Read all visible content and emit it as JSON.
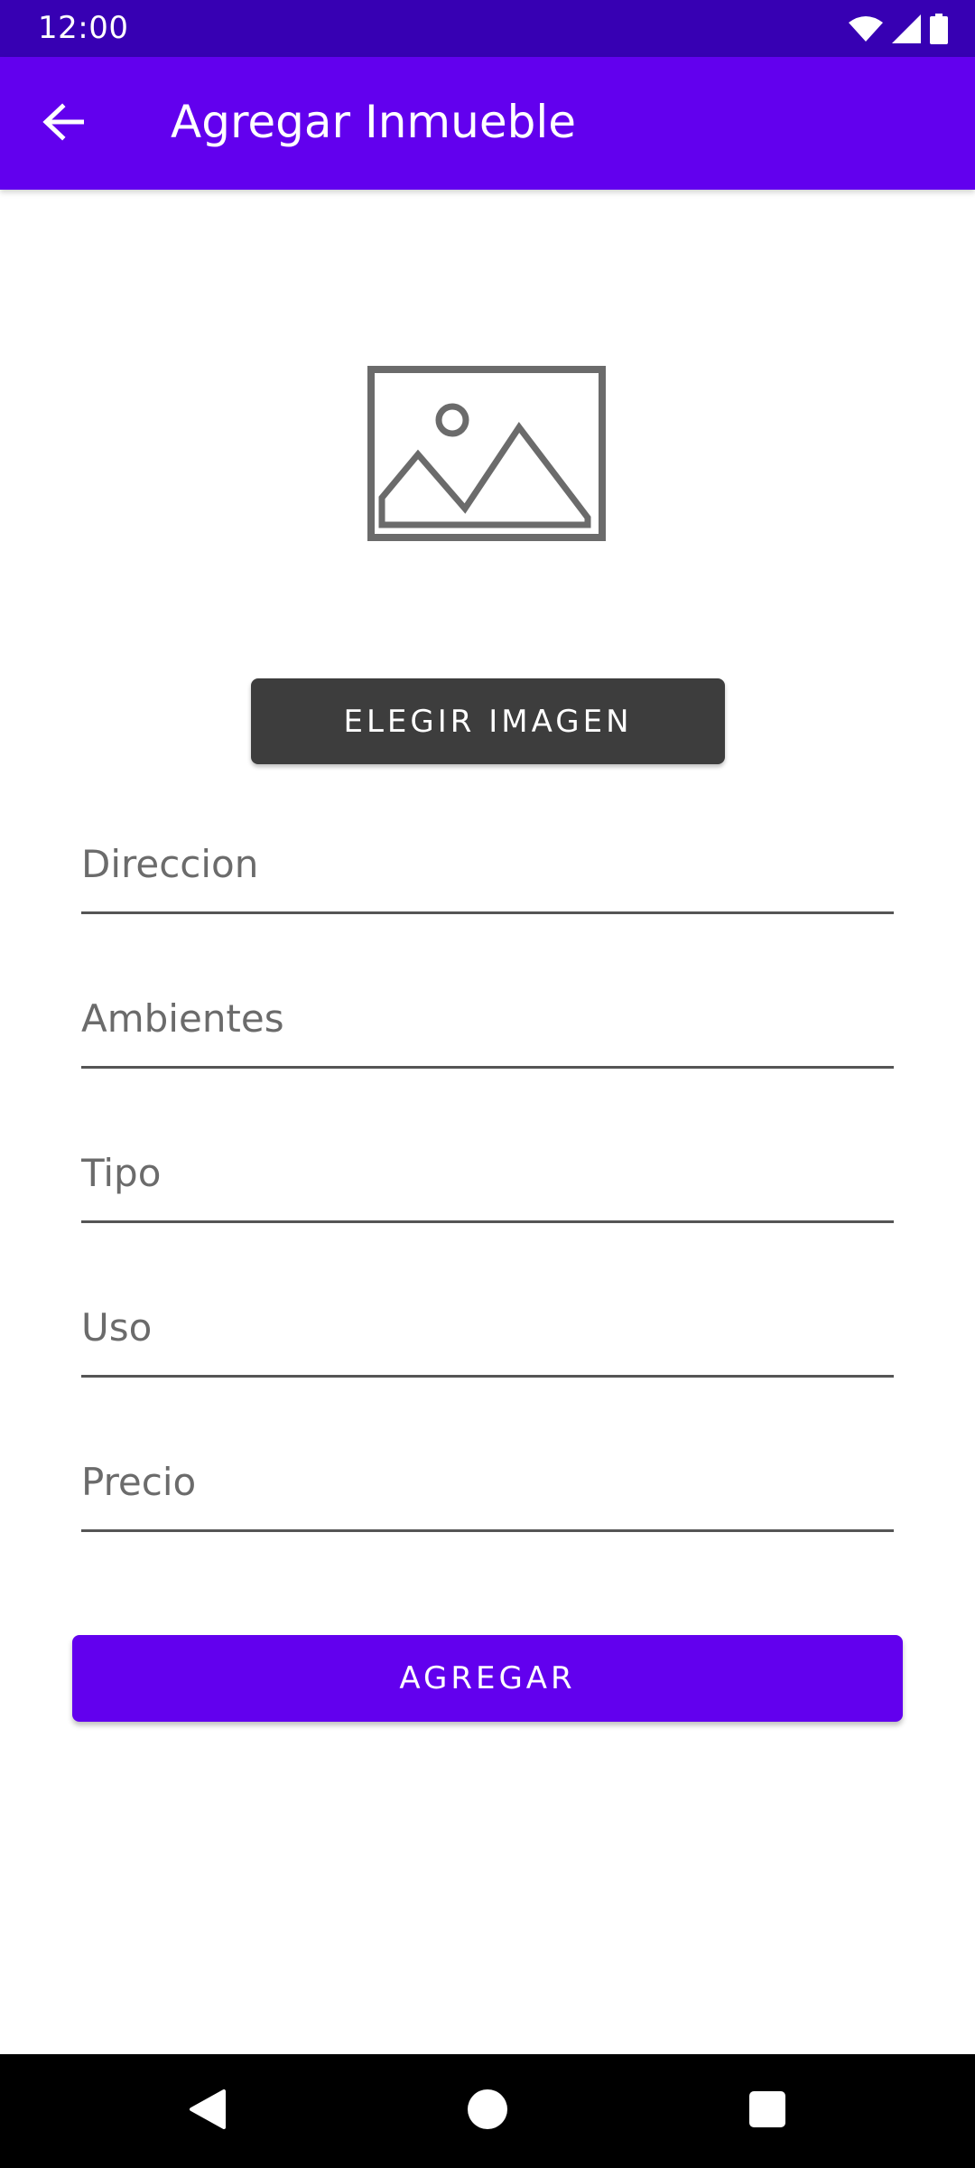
{
  "status_bar": {
    "time": "12:00",
    "icons": [
      "wifi-icon",
      "cellular-signal-icon",
      "battery-icon"
    ]
  },
  "app_bar": {
    "title": "Agregar Inmueble",
    "back_icon": "arrow-back-icon"
  },
  "image_preview": {
    "icon": "image-placeholder-icon"
  },
  "choose_image_button": {
    "label": "ELEGIR IMAGEN"
  },
  "form": {
    "fields": [
      {
        "id": "direccion",
        "placeholder": "Direccion",
        "value": ""
      },
      {
        "id": "ambientes",
        "placeholder": "Ambientes",
        "value": ""
      },
      {
        "id": "tipo",
        "placeholder": "Tipo",
        "value": ""
      },
      {
        "id": "uso",
        "placeholder": "Uso",
        "value": ""
      },
      {
        "id": "precio",
        "placeholder": "Precio",
        "value": ""
      }
    ]
  },
  "submit_button": {
    "label": "AGREGAR"
  },
  "nav_bar": {
    "buttons": [
      "nav-back-icon",
      "nav-home-icon",
      "nav-recents-icon"
    ]
  },
  "colors": {
    "primary": "#6200EE",
    "primary_dark": "#3700B3",
    "secondary_button": "#3d3d3d",
    "nav_bar": "#000000"
  }
}
